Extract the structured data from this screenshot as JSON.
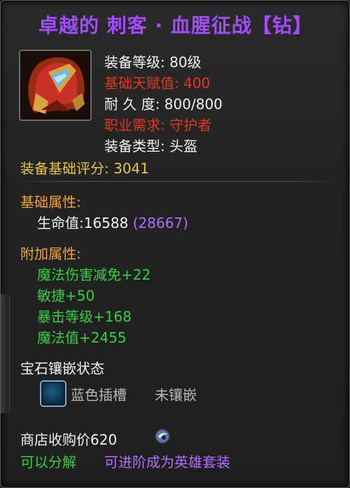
{
  "item": {
    "title": "卓越的 刺客 · 血腥征战【钻】",
    "equip_level": "装备等级: 80级",
    "talent_value": "基础天赋值: 400",
    "durability": "耐 久 度: 800/800",
    "class_requirement": "职业需求: 守护者",
    "equip_type": "装备类型: 头盔",
    "base_score": "装备基础评分: 3041"
  },
  "base_attributes": {
    "header": "基础属性:",
    "hp_label": "生命值:16588",
    "hp_extra": "(28667)"
  },
  "extra_attributes": {
    "header": "附加属性:",
    "items": [
      "魔法伤害减免+22",
      "敏捷+50",
      "暴击等级+168",
      "魔法值+2455"
    ]
  },
  "gem": {
    "header": "宝石镶嵌状态",
    "socket_label": "蓝色插槽",
    "socket_status": "未镶嵌"
  },
  "footer": {
    "sell_price": "商店收购价620",
    "decompose": "可以分解",
    "upgrade": "可进阶成为英雄套装"
  },
  "colors": {
    "title": "#a34cff",
    "white": "#f2f2f2",
    "red": "#e3361f",
    "yellow": "#e7c34a",
    "orange": "#f0a33a",
    "green": "#33d13f",
    "purple": "#b36cff"
  },
  "icons": {
    "item": "helmet-icon",
    "socket": "blue-socket-icon",
    "currency": "coin-icon"
  }
}
